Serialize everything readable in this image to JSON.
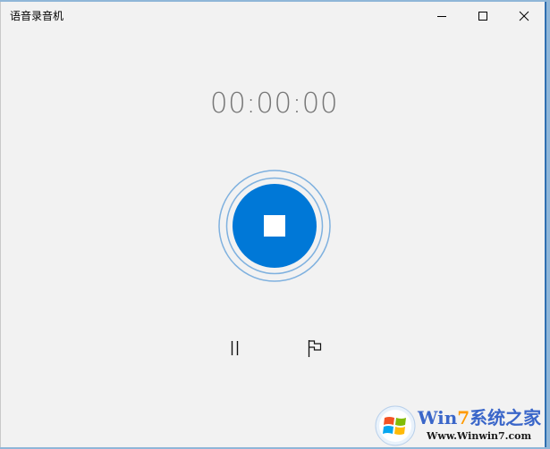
{
  "window": {
    "title": "语音录音机",
    "controls": {
      "minimize_icon": "minimize-icon",
      "maximize_icon": "maximize-icon",
      "close_icon": "close-icon"
    }
  },
  "recorder": {
    "elapsed": "00:00:00",
    "stop_icon": "stop-icon",
    "pause_icon": "pause-icon",
    "marker_icon": "flag-icon"
  },
  "colors": {
    "accent": "#0078d7",
    "ring": "#7fb1df",
    "background": "#f2f2f2",
    "timer_text": "#777777"
  },
  "watermark": {
    "brand_prefix": "Win",
    "brand_seven": "7",
    "brand_suffix": "系统之家",
    "url": "Www.Winwin7.com"
  }
}
